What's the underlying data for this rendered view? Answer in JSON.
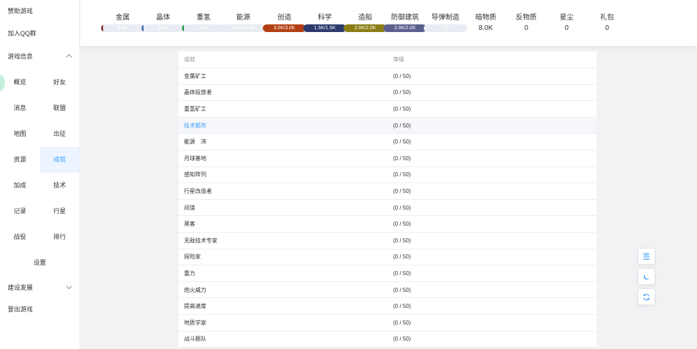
{
  "sidebar": {
    "sponsor": "赞助游戏",
    "join_qq": "加入QQ群",
    "game_info": "游戏信息",
    "grid": [
      "概览",
      "好友",
      "消息",
      "联盟",
      "地图",
      "出征",
      "资源",
      "成就",
      "加成",
      "技术",
      "记录",
      "行星",
      "战役",
      "排行"
    ],
    "settings": "设置",
    "build": "建设发展",
    "logout": "登出游戏"
  },
  "resources": [
    {
      "name": "金属",
      "bar": "3.0K",
      "fill": 0.05,
      "color": "#8b3a3a"
    },
    {
      "name": "晶体",
      "bar": "2.5K",
      "fill": 0.04,
      "color": "#4b6cb7"
    },
    {
      "name": "重氢",
      "bar": "2.5K",
      "fill": 0.04,
      "color": "#2e9e5b"
    },
    {
      "name": "能源",
      "bar": "-0.0K/0.0K",
      "fill": 0.0,
      "color": "#c0c4cc"
    },
    {
      "name": "创造",
      "bar": "3.0K/3.0K",
      "fill": 1.0,
      "color": "#b33f12"
    },
    {
      "name": "科学",
      "bar": "1.5K/1.5K",
      "fill": 1.0,
      "color": "#2b3a6b"
    },
    {
      "name": "造船",
      "bar": "2.0K/2.0K",
      "fill": 1.0,
      "color": "#8a7d14"
    },
    {
      "name": "防御建筑",
      "bar": "2.0K/2.0K",
      "fill": 1.0,
      "color": "#5a5f8e"
    },
    {
      "name": "导弹制造",
      "bar": "0/0",
      "fill": 0.0,
      "color": "#c0c4cc"
    },
    {
      "name": "暗物质",
      "value": "8.0K"
    },
    {
      "name": "反物质",
      "value": "0"
    },
    {
      "name": "星尘",
      "value": "0"
    },
    {
      "name": "礼包",
      "value": "0"
    }
  ],
  "table": {
    "headers": [
      "成就",
      "等级"
    ],
    "rows": [
      [
        "金属矿工",
        "(0 / 50)"
      ],
      [
        "晶体投放者",
        "(0 / 50)"
      ],
      [
        "重氢矿工",
        "(0 / 50)"
      ],
      [
        "技术都市",
        "(0 / 50)"
      ],
      [
        "能源　沛",
        "(0 / 50)"
      ],
      [
        "月球基地",
        "(0 / 50)"
      ],
      [
        "感知阵列",
        "(0 / 50)"
      ],
      [
        "行星改造者",
        "(0 / 50)"
      ],
      [
        "间谍",
        "(0 / 50)"
      ],
      [
        "黑客",
        "(0 / 50)"
      ],
      [
        "无敌技术专家",
        "(0 / 50)"
      ],
      [
        "探险家",
        "(0 / 50)"
      ],
      [
        "重力",
        "(0 / 50)"
      ],
      [
        "炮火威力",
        "(0 / 50)"
      ],
      [
        "提高速度",
        "(0 / 50)"
      ],
      [
        "地质学家",
        "(0 / 50)"
      ],
      [
        "战斗舰队",
        "(0 / 50)"
      ]
    ]
  },
  "fab": {
    "sign": "签"
  }
}
